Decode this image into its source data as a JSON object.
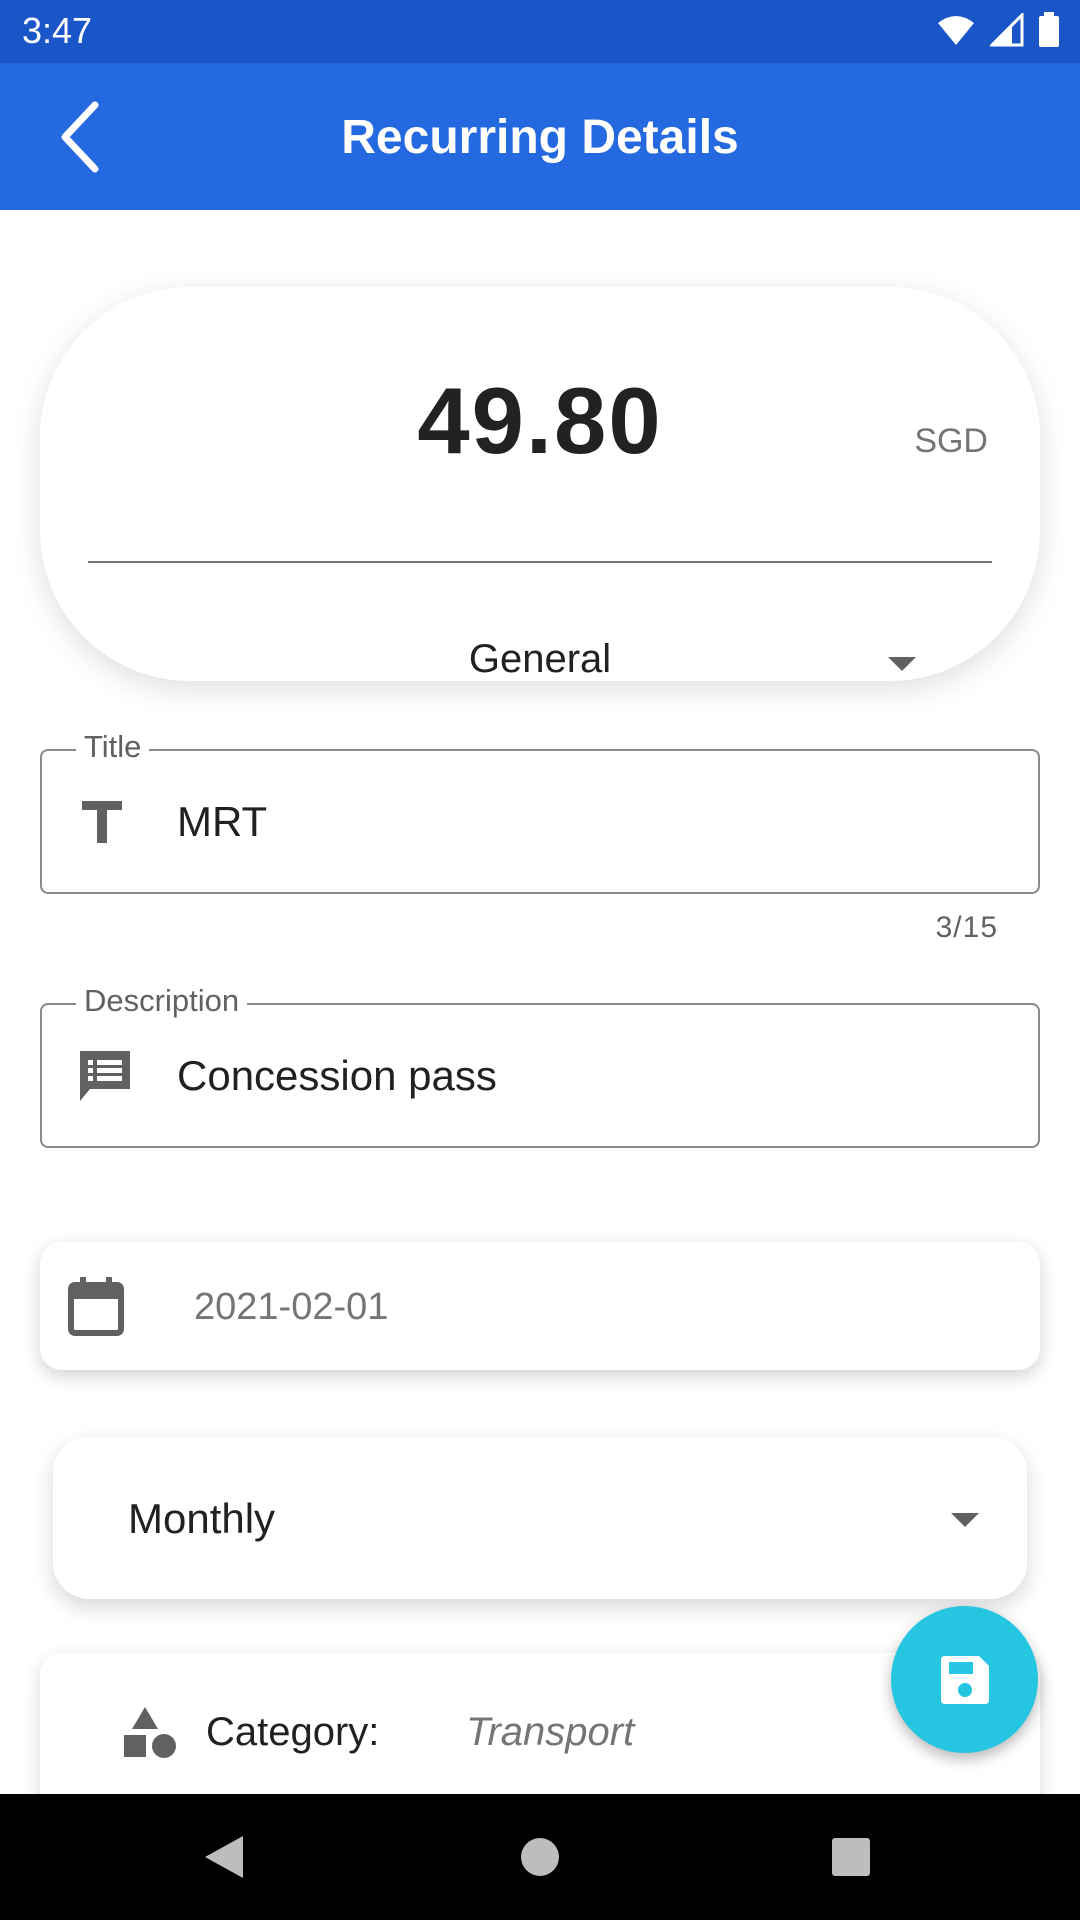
{
  "status_bar": {
    "time": "3:47"
  },
  "app_bar": {
    "title": "Recurring Details"
  },
  "amount": {
    "value": "49.80",
    "currency": "SGD",
    "account": "General"
  },
  "title_field": {
    "label": "Title",
    "value": "MRT",
    "counter": "3/15"
  },
  "description_field": {
    "label": "Description",
    "value": "Concession pass"
  },
  "date": {
    "value": "2021-02-01"
  },
  "frequency": {
    "value": "Monthly"
  },
  "category": {
    "label": "Category:",
    "value": "Transport"
  },
  "icons": {
    "back": "arrow-back-icon",
    "title": "text-fields-icon",
    "description": "notes-icon",
    "date": "calendar-icon",
    "category": "category-icon",
    "save": "save-icon"
  },
  "colors": {
    "status_bar": "#1a56c8",
    "app_bar": "#2569e0",
    "fab": "#26c6e3"
  }
}
